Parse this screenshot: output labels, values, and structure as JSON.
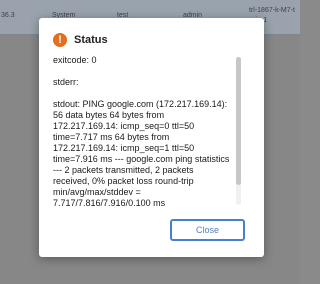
{
  "background_row": {
    "cells": [
      "36.3",
      "System",
      "test",
      "admin",
      "trl-1867-k-M7-t"
    ],
    "cell_line2": "im1"
  },
  "dialog": {
    "title": "Status",
    "icon": "exclamation-circle-icon",
    "accent_color": "#e36f1e",
    "exitcode": "exitcode: 0",
    "stderr": "stderr:",
    "stdout": "stdout: PING google.com (172.217.169.14): 56 data bytes 64 bytes from 172.217.169.14: icmp_seq=0 ttl=50 time=7.717 ms 64 bytes from 172.217.169.14: icmp_seq=1 ttl=50 time=7.916 ms --- google.com ping statistics --- 2 packets transmitted, 2 packets received, 0% packet loss round-trip min/avg/max/stddev = 7.717/7.816/7.916/0.100 ms",
    "close_label": "Close",
    "button_color": "#4a7fd0"
  }
}
